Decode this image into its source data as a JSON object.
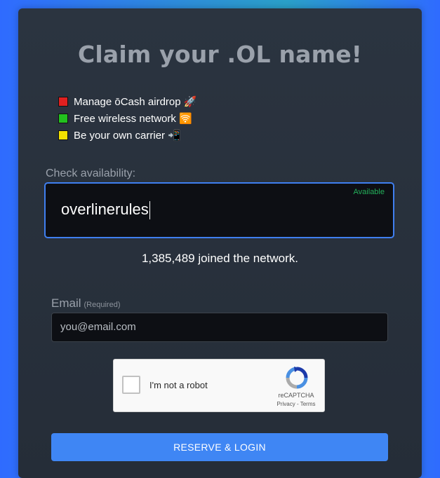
{
  "title": "Claim your .OL name!",
  "features": [
    {
      "text": "Manage ōCash airdrop 🚀",
      "color": "#e02020"
    },
    {
      "text": "Free wireless network 🛜",
      "color": "#22c01e"
    },
    {
      "text": "Be your own carrier 📲",
      "color": "#f4e200"
    }
  ],
  "availability": {
    "label": "Check availability:",
    "value": "overlinerules",
    "status": "Available",
    "status_color": "#23b05a"
  },
  "network": {
    "joined_text": "1,385,489 joined the network."
  },
  "email": {
    "label": "Email",
    "required_label": "(Required)",
    "placeholder": "you@email.com"
  },
  "recaptcha": {
    "label": "I'm not a robot",
    "brand": "reCAPTCHA",
    "links": "Privacy - Terms",
    "icon": "recaptcha-logo"
  },
  "submit": {
    "label": "RESERVE & LOGIN",
    "color": "#3f86f4"
  }
}
